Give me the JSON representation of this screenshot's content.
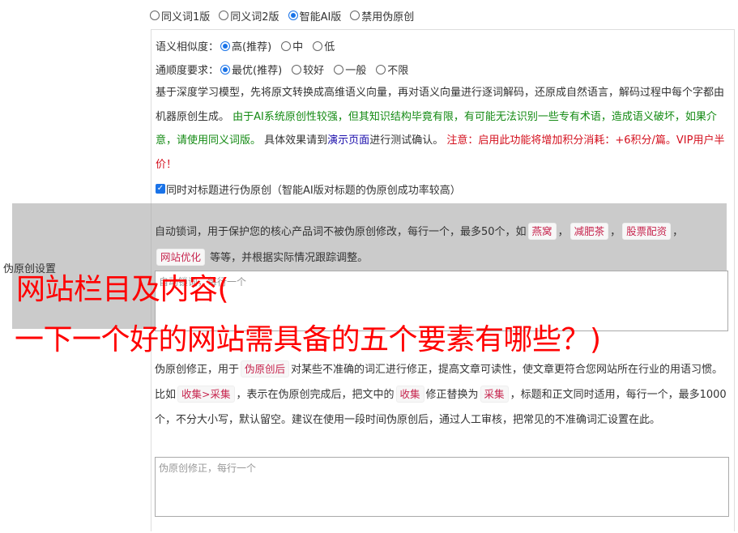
{
  "mode_options": [
    {
      "label": "同义词1版",
      "checked": false
    },
    {
      "label": "同义词2版",
      "checked": false
    },
    {
      "label": "智能AI版",
      "checked": true
    },
    {
      "label": "禁用伪原创",
      "checked": false
    }
  ],
  "similarity": {
    "label": "语义相似度：",
    "options": [
      {
        "label": "高(推荐)",
        "checked": true
      },
      {
        "label": "中",
        "checked": false
      },
      {
        "label": "低",
        "checked": false
      }
    ]
  },
  "fluency": {
    "label": "通顺度要求：",
    "options": [
      {
        "label": "最优(推荐)",
        "checked": true
      },
      {
        "label": "较好",
        "checked": false
      },
      {
        "label": "一般",
        "checked": false
      },
      {
        "label": "不限",
        "checked": false
      }
    ]
  },
  "description": {
    "part1": "基于深度学习模型，先将原文转换成高维语义向量，再对语义向量进行逐词解码，还原成自然语言，解码过程中每个字都由机器原创生成。",
    "part2_green": "由于AI系统原创性较强，但其知识结构毕竟有限，有可能无法识别一些专有术语，造成语义破坏，如果介意，请使用同义词版。",
    "part3": "具体效果请到",
    "link": "演示页面",
    "part4": "进行测试确认。",
    "part5_red": "注意：启用此功能将增加积分消耗：+6积分/篇。VIP用户半价！"
  },
  "title_checkbox": {
    "label": "同时对标题进行伪原创（智能AI版对标题的伪原创成功率较高）",
    "checked": true
  },
  "lock": {
    "desc1": "自动锁词，用于保护您的核心产品词不被伪原创修改，每行一个，最多50个，如",
    "tags": [
      "燕窝",
      "减肥茶",
      "股票配资",
      "网站优化"
    ],
    "desc2": "等等，并根据实际情况跟踪调整。",
    "placeholder": "自动锁词，每行一个"
  },
  "side_label": "伪原创设置",
  "overlay": {
    "line1": "网站栏目及内容(",
    "line2": "一下一个好的网站需具备的五个要素有哪些？)"
  },
  "fix": {
    "desc1": "伪原创修正，用于",
    "tag1": "伪原创后",
    "desc2": "对某些不准确的词汇进行修正，提高文章可读性，使文章更符合您网站所在行业的用语习惯。比如",
    "tag2": "收集>采集",
    "desc3": "，表示在伪原创完成后，把文中的",
    "tag3": "收集",
    "desc4": "修正替换为",
    "tag4": "采集",
    "desc5": "，标题和正文同时适用，每行一个，最多1000个，不分大小写，默认留空。建议在使用一段时间伪原创后，通过人工审核，把常见的不准确词汇设置在此。",
    "placeholder": "伪原创修正，每行一个"
  }
}
